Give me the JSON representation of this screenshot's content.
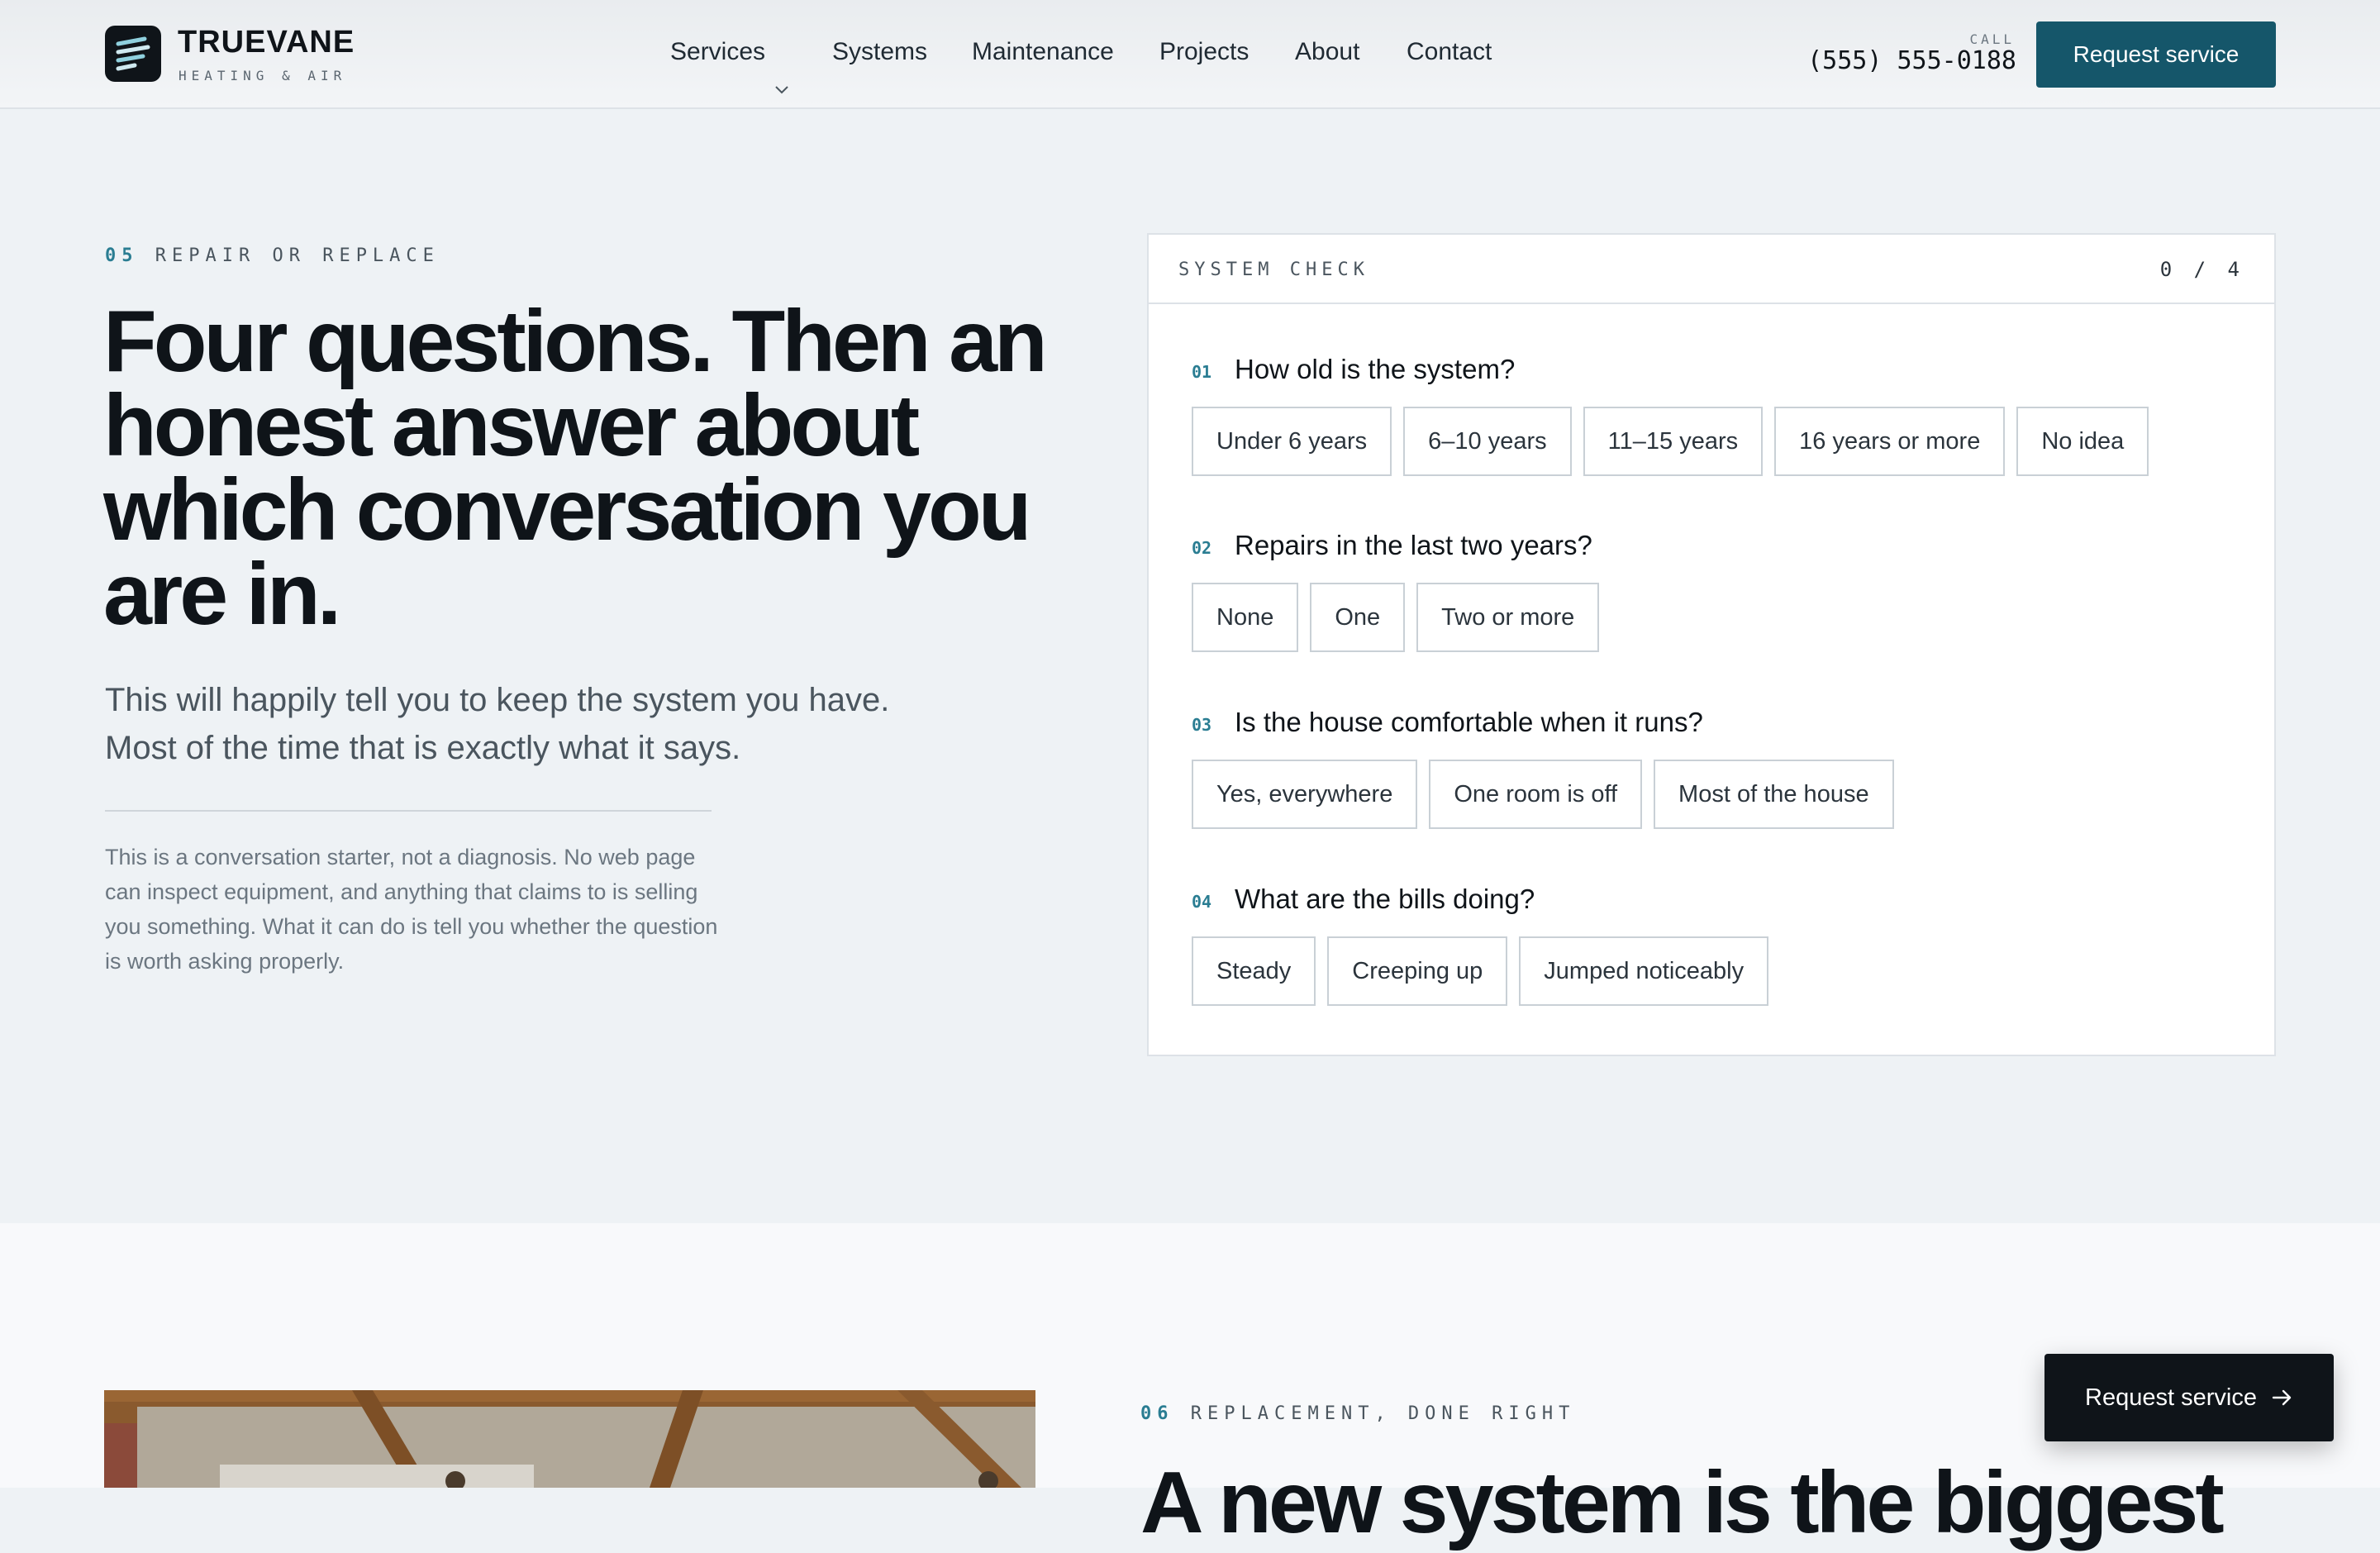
{
  "brand": {
    "name": "TRUEVANE",
    "tagline": "HEATING & AIR"
  },
  "nav": {
    "items": [
      {
        "label": "Services",
        "has_dropdown": true
      },
      {
        "label": "Systems"
      },
      {
        "label": "Maintenance"
      },
      {
        "label": "Projects"
      },
      {
        "label": "About"
      },
      {
        "label": "Contact"
      }
    ]
  },
  "header": {
    "call_label": "CALL",
    "phone": "(555) 555-0188",
    "cta_label": "Request service"
  },
  "intro": {
    "eyebrow_num": "05",
    "eyebrow_label": "REPAIR OR REPLACE",
    "headline": "Four questions. Then an honest answer about which conversation you are in.",
    "lede": "This will happily tell you to keep the system you have. Most of the time that is exactly what it says.",
    "disclaimer": "This is a conversation starter, not a diagnosis. No web page can inspect equipment, and anything that claims to is selling you something. What it can do is tell you whether the question is worth asking properly."
  },
  "check": {
    "title": "SYSTEM CHECK",
    "progress": "0 / 4",
    "questions": [
      {
        "num": "01",
        "text": "How old is the system?",
        "options": [
          "Under 6 years",
          "6–10 years",
          "11–15 years",
          "16 years or more",
          "No idea"
        ]
      },
      {
        "num": "02",
        "text": "Repairs in the last two years?",
        "options": [
          "None",
          "One",
          "Two or more"
        ]
      },
      {
        "num": "03",
        "text": "Is the house comfortable when it runs?",
        "options": [
          "Yes, everywhere",
          "One room is off",
          "Most of the house"
        ]
      },
      {
        "num": "04",
        "text": "What are the bills doing?",
        "options": [
          "Steady",
          "Creeping up",
          "Jumped noticeably"
        ]
      }
    ]
  },
  "next_section": {
    "eyebrow_num": "06",
    "eyebrow_label": "REPLACEMENT, DONE RIGHT",
    "headline": "A new system is the biggest"
  },
  "floating_cta": {
    "label": "Request service",
    "icon": "arrow-right-icon"
  },
  "colors": {
    "accent": "#15566a",
    "accent_text": "#2a7d92",
    "ink": "#0f1419",
    "page_bg": "#eef2f5"
  }
}
